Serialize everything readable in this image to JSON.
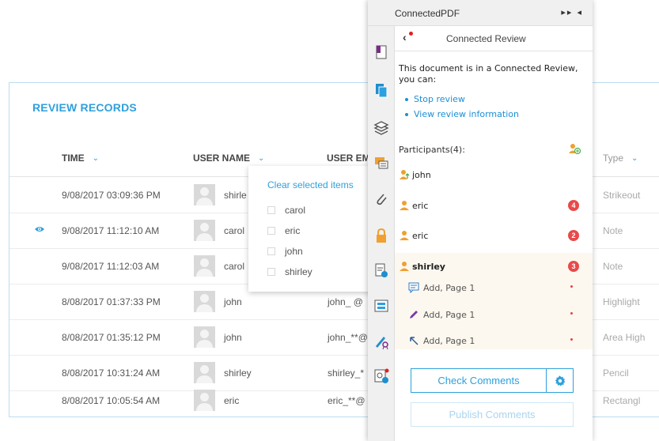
{
  "records": {
    "title": "REVIEW RECORDS",
    "columns": {
      "time": "TIME",
      "user_name": "USER NAME",
      "user_email": "USER EM",
      "type": "Type"
    },
    "rows": [
      {
        "time": "9/08/2017  03:09:36 PM",
        "user": "shirle",
        "email": "",
        "type": "Strikeout",
        "viewed": false
      },
      {
        "time": "9/08/2017  11:12:10 AM",
        "user": "carol",
        "email": "",
        "type": "Note",
        "viewed": true
      },
      {
        "time": "9/08/2017  11:12:03 AM",
        "user": "carol",
        "email": "",
        "type": "Note",
        "viewed": false
      },
      {
        "time": "8/08/2017  01:37:33 PM",
        "user": "john",
        "email": "john_  @",
        "type": "Highlight",
        "viewed": false
      },
      {
        "time": "8/08/2017  01:35:12 PM",
        "user": "john",
        "email": "john_**@",
        "type": "Area High",
        "viewed": false
      },
      {
        "time": "8/08/2017  10:31:24 AM",
        "user": "shirley",
        "email": "shirley_*",
        "type": "Pencil",
        "viewed": false
      },
      {
        "time": "8/08/2017  10:05:54 AM",
        "user": "eric",
        "email": "eric_**@",
        "type": "Rectangl",
        "viewed": false
      }
    ]
  },
  "filter_dropdown": {
    "clear_label": "Clear selected items",
    "options": [
      "carol",
      "eric",
      "john",
      "shirley"
    ]
  },
  "panel": {
    "title": "ConnectedPDF",
    "controls": "▸▸ ◂",
    "review_title": "Connected Review",
    "intro": "This document is in a Connected Review, you can:",
    "links": [
      "Stop review",
      "View review information"
    ],
    "participants_label": "Participants(4):",
    "participants": [
      {
        "name": "john",
        "badge": "",
        "owner": true
      },
      {
        "name": "eric",
        "badge": "4",
        "owner": false
      },
      {
        "name": "eric",
        "badge": "2",
        "owner": false
      },
      {
        "name": "shirley",
        "badge": "3",
        "owner": false
      }
    ],
    "shirley_items": [
      {
        "icon": "note-icon",
        "text": "Add, Page 1"
      },
      {
        "icon": "pencil-icon",
        "text": "Add, Page 1"
      },
      {
        "icon": "arrow-up-left-icon",
        "text": "Add, Page 1"
      }
    ],
    "check_comments": "Check Comments",
    "publish_comments": "Publish Comments"
  },
  "colors": {
    "accent": "#2ea0dc",
    "badge_red": "#e84a4a",
    "person_orange": "#f0a030"
  }
}
